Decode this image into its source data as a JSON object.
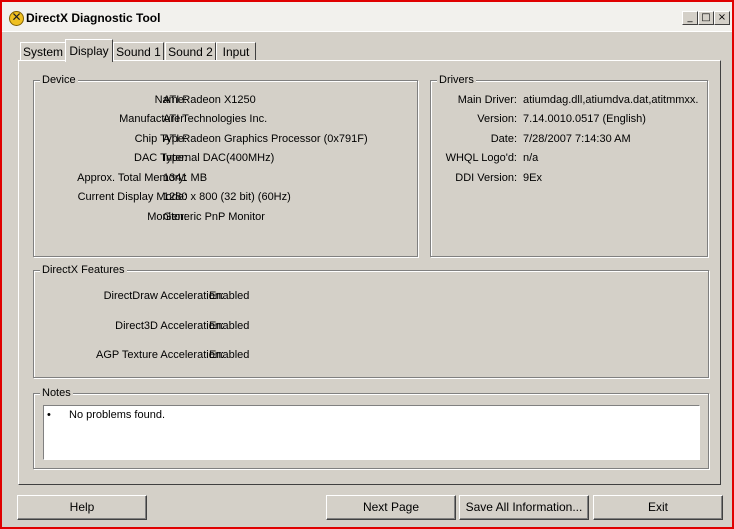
{
  "window": {
    "title": "DirectX Diagnostic Tool"
  },
  "titlebar_buttons": {
    "minimize": "_",
    "maximize": "□",
    "close": "×"
  },
  "tabs": [
    {
      "label": "System"
    },
    {
      "label": "Display"
    },
    {
      "label": "Sound 1"
    },
    {
      "label": "Sound 2"
    },
    {
      "label": "Input"
    }
  ],
  "active_tab": "Display",
  "device": {
    "title": "Device",
    "rows": [
      {
        "label": "Name:",
        "value": "ATI Radeon X1250"
      },
      {
        "label": "Manufacturer:",
        "value": "ATI Technologies Inc."
      },
      {
        "label": "Chip Type:",
        "value": "ATI Radeon Graphics Processor (0x791F)"
      },
      {
        "label": "DAC Type:",
        "value": "Internal DAC(400MHz)"
      },
      {
        "label": "Approx. Total Memory:",
        "value": "1341 MB"
      },
      {
        "label": "Current Display Mode:",
        "value": "1280 x 800 (32 bit) (60Hz)"
      },
      {
        "label": "Monitor:",
        "value": "Generic PnP Monitor"
      }
    ]
  },
  "drivers": {
    "title": "Drivers",
    "rows": [
      {
        "label": "Main Driver:",
        "value": "atiumdag.dll,atiumdva.dat,atitmmxx."
      },
      {
        "label": "Version:",
        "value": "7.14.0010.0517 (English)"
      },
      {
        "label": "Date:",
        "value": "7/28/2007 7:14:30 AM"
      },
      {
        "label": "WHQL Logo'd:",
        "value": "n/a"
      },
      {
        "label": "DDI Version:",
        "value": "9Ex"
      }
    ]
  },
  "features": {
    "title": "DirectX Features",
    "rows": [
      {
        "label": "DirectDraw Acceleration:",
        "value": "Enabled"
      },
      {
        "label": "Direct3D Acceleration:",
        "value": "Enabled"
      },
      {
        "label": "AGP Texture Acceleration:",
        "value": "Enabled"
      }
    ]
  },
  "notes": {
    "title": "Notes",
    "bullet": "•",
    "text": "No problems found."
  },
  "buttons": {
    "help": "Help",
    "next_page": "Next Page",
    "save_all": "Save All Information...",
    "exit": "Exit"
  }
}
